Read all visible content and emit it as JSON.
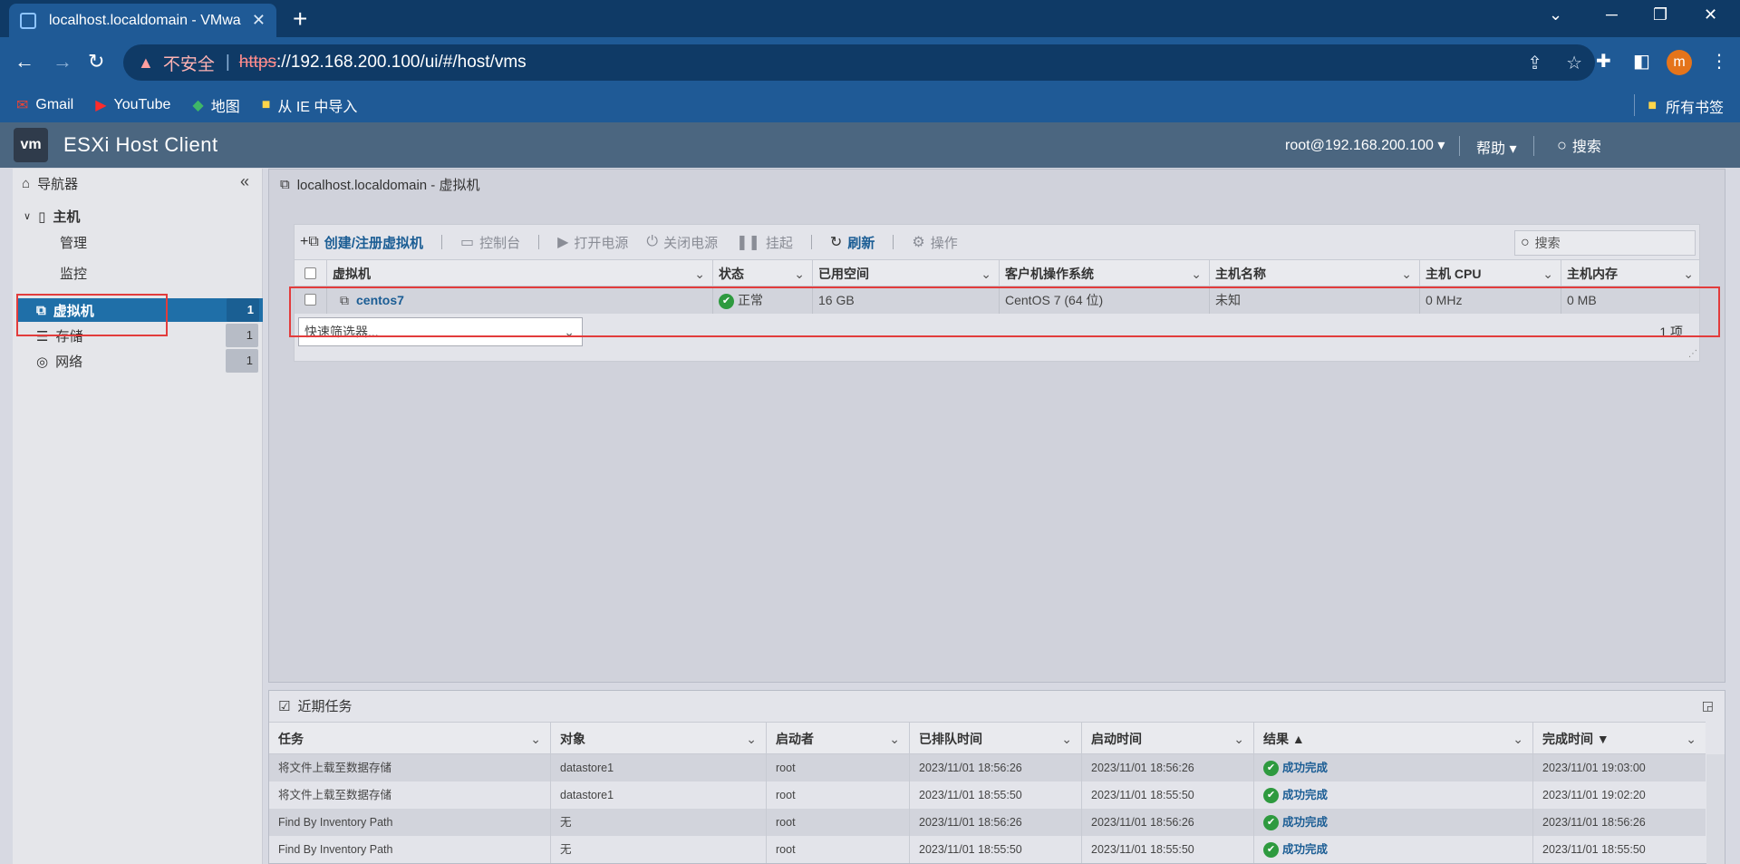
{
  "browser": {
    "tab_title": "localhost.localdomain - VMwa",
    "url_insecure_label": "不安全",
    "url_scheme": "https",
    "url_rest": "://192.168.200.100/ui/#/host/vms",
    "profile_initial": "m",
    "bookmarks": [
      {
        "label": "Gmail",
        "icon": "gmail-icon"
      },
      {
        "label": "YouTube",
        "icon": "youtube-icon"
      },
      {
        "label": "地图",
        "icon": "maps-icon"
      },
      {
        "label": "从 IE 中导入",
        "icon": "folder-icon"
      }
    ],
    "all_bookmarks": "所有书签"
  },
  "esxi": {
    "logo": "vm",
    "app_title": "ESXi Host Client",
    "user": "root@192.168.200.100 ▾",
    "help": "帮助 ▾",
    "search": "搜索"
  },
  "navigator": {
    "title": "导航器",
    "host": "主机",
    "manage": "管理",
    "monitor": "监控",
    "vms": "虚拟机",
    "vms_count": "1",
    "storage": "存储",
    "storage_count": "1",
    "network": "网络",
    "network_count": "1"
  },
  "main": {
    "title": "localhost.localdomain - 虚拟机",
    "toolbar": {
      "create": "创建/注册虚拟机",
      "console": "控制台",
      "power_on": "打开电源",
      "power_off": "关闭电源",
      "suspend": "挂起",
      "refresh": "刷新",
      "actions": "操作",
      "search_placeholder": "搜索"
    },
    "columns": [
      "虚拟机",
      "状态",
      "已用空间",
      "客户机操作系统",
      "主机名称",
      "主机 CPU",
      "主机内存"
    ],
    "rows": [
      {
        "name": "centos7",
        "status": "正常",
        "used": "16 GB",
        "os": "CentOS 7 (64 位)",
        "hostname": "未知",
        "cpu": "0 MHz",
        "mem": "0 MB"
      }
    ],
    "filter_placeholder": "快速筛选器...",
    "count": "1 项"
  },
  "tasks": {
    "title": "近期任务",
    "columns": [
      "任务",
      "对象",
      "启动者",
      "已排队时间",
      "启动时间",
      "结果 ▲",
      "完成时间 ▼"
    ],
    "rows": [
      {
        "task": "将文件上载至数据存储",
        "target": "datastore1",
        "initiator": "root",
        "queued": "2023/11/01 18:56:26",
        "started": "2023/11/01 18:56:26",
        "result": "成功完成",
        "completed": "2023/11/01 19:03:00"
      },
      {
        "task": "将文件上载至数据存储",
        "target": "datastore1",
        "initiator": "root",
        "queued": "2023/11/01 18:55:50",
        "started": "2023/11/01 18:55:50",
        "result": "成功完成",
        "completed": "2023/11/01 19:02:20"
      },
      {
        "task": "Find By Inventory Path",
        "target": "无",
        "initiator": "root",
        "queued": "2023/11/01 18:56:26",
        "started": "2023/11/01 18:56:26",
        "result": "成功完成",
        "completed": "2023/11/01 18:56:26"
      },
      {
        "task": "Find By Inventory Path",
        "target": "无",
        "initiator": "root",
        "queued": "2023/11/01 18:55:50",
        "started": "2023/11/01 18:55:50",
        "result": "成功完成",
        "completed": "2023/11/01 18:55:50"
      }
    ]
  },
  "colors": {
    "browser_dark": "#0f3a66",
    "browser_tab": "#1f5a96",
    "esxi_header": "#4b6680",
    "selection": "#1f6fa8",
    "highlight_box": "#e23c3c",
    "success": "#2e9a3f"
  }
}
